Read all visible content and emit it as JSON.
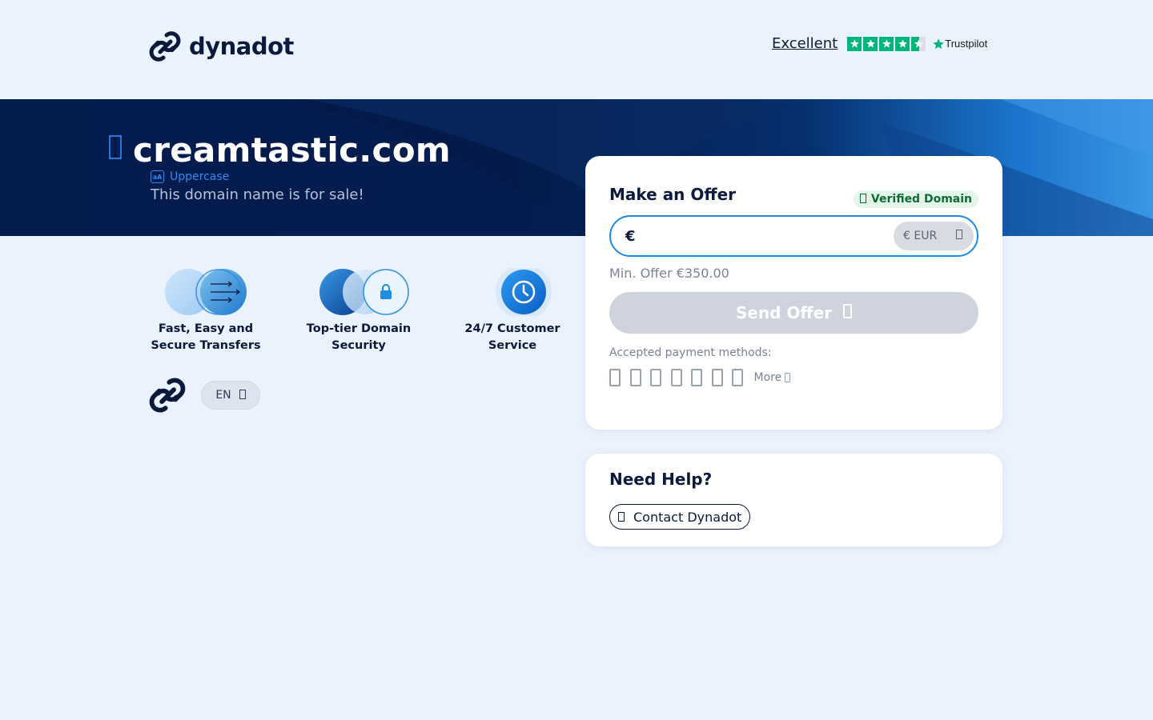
{
  "header": {
    "brand": "dynadot",
    "trustpilot": {
      "rating_text": "Excellent",
      "stars": 4.5,
      "brand": "Trustpilot"
    }
  },
  "hero": {
    "domain": "creamtastic.com",
    "uppercase_label": "Uppercase",
    "for_sale_text": "This domain name is for sale!"
  },
  "features": [
    {
      "caption": "Fast, Easy and Secure Transfers"
    },
    {
      "caption": "Top-tier Domain Security"
    },
    {
      "caption": "24/7 Customer Service"
    }
  ],
  "language": {
    "selected": "EN"
  },
  "offer": {
    "title": "Make an Offer",
    "verified_badge": "Verified Domain",
    "currency_symbol": "€",
    "amount_value": "",
    "currency_select": "€ EUR",
    "min_offer": "Min. Offer €350.00",
    "send_label": "Send Offer",
    "payment_label": "Accepted payment methods:",
    "payment_method_count": 7,
    "more_label": "More"
  },
  "help": {
    "title": "Need Help?",
    "contact_label": "Contact Dynadot"
  },
  "colors": {
    "accent": "#1a8ae6",
    "navy": "#0b1a3c",
    "trustpilot_green": "#00b67a",
    "verified_bg": "#e3f6e9",
    "verified_text": "#0d6b35",
    "button_disabled": "#cfd3de"
  },
  "icons": [
    "dynadot-logo-icon",
    "lock-icon",
    "uppercase-icon",
    "star-icon",
    "check-icon",
    "chevron-down-icon",
    "arrow-right-icon",
    "payment-card-icon",
    "phone-icon",
    "clock-icon",
    "transfer-icon",
    "padlock-icon"
  ]
}
